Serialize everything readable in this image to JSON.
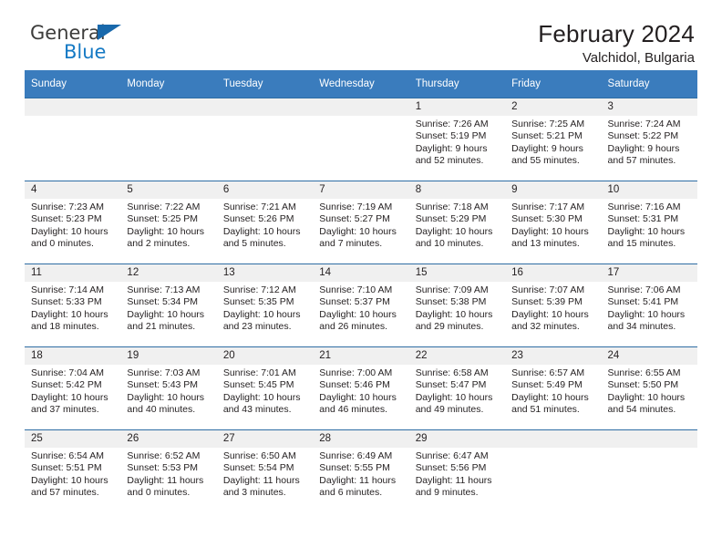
{
  "brand": {
    "name_top": "General",
    "name_bottom": "Blue",
    "triangle_color": "#1868ab",
    "blue_color": "#1479c4"
  },
  "header": {
    "title": "February 2024",
    "subtitle": "Valchidol, Bulgaria"
  },
  "theme": {
    "header_bg": "#3a7cbd",
    "row_rule": "#2e6da4",
    "daynum_band": "#f0f0f0"
  },
  "weekdays": [
    "Sunday",
    "Monday",
    "Tuesday",
    "Wednesday",
    "Thursday",
    "Friday",
    "Saturday"
  ],
  "weeks": [
    [
      {
        "day": "",
        "sunrise": "",
        "sunset": "",
        "daylight_1": "",
        "daylight_2": ""
      },
      {
        "day": "",
        "sunrise": "",
        "sunset": "",
        "daylight_1": "",
        "daylight_2": ""
      },
      {
        "day": "",
        "sunrise": "",
        "sunset": "",
        "daylight_1": "",
        "daylight_2": ""
      },
      {
        "day": "",
        "sunrise": "",
        "sunset": "",
        "daylight_1": "",
        "daylight_2": ""
      },
      {
        "day": "1",
        "sunrise": "Sunrise: 7:26 AM",
        "sunset": "Sunset: 5:19 PM",
        "daylight_1": "Daylight: 9 hours",
        "daylight_2": "and 52 minutes."
      },
      {
        "day": "2",
        "sunrise": "Sunrise: 7:25 AM",
        "sunset": "Sunset: 5:21 PM",
        "daylight_1": "Daylight: 9 hours",
        "daylight_2": "and 55 minutes."
      },
      {
        "day": "3",
        "sunrise": "Sunrise: 7:24 AM",
        "sunset": "Sunset: 5:22 PM",
        "daylight_1": "Daylight: 9 hours",
        "daylight_2": "and 57 minutes."
      }
    ],
    [
      {
        "day": "4",
        "sunrise": "Sunrise: 7:23 AM",
        "sunset": "Sunset: 5:23 PM",
        "daylight_1": "Daylight: 10 hours",
        "daylight_2": "and 0 minutes."
      },
      {
        "day": "5",
        "sunrise": "Sunrise: 7:22 AM",
        "sunset": "Sunset: 5:25 PM",
        "daylight_1": "Daylight: 10 hours",
        "daylight_2": "and 2 minutes."
      },
      {
        "day": "6",
        "sunrise": "Sunrise: 7:21 AM",
        "sunset": "Sunset: 5:26 PM",
        "daylight_1": "Daylight: 10 hours",
        "daylight_2": "and 5 minutes."
      },
      {
        "day": "7",
        "sunrise": "Sunrise: 7:19 AM",
        "sunset": "Sunset: 5:27 PM",
        "daylight_1": "Daylight: 10 hours",
        "daylight_2": "and 7 minutes."
      },
      {
        "day": "8",
        "sunrise": "Sunrise: 7:18 AM",
        "sunset": "Sunset: 5:29 PM",
        "daylight_1": "Daylight: 10 hours",
        "daylight_2": "and 10 minutes."
      },
      {
        "day": "9",
        "sunrise": "Sunrise: 7:17 AM",
        "sunset": "Sunset: 5:30 PM",
        "daylight_1": "Daylight: 10 hours",
        "daylight_2": "and 13 minutes."
      },
      {
        "day": "10",
        "sunrise": "Sunrise: 7:16 AM",
        "sunset": "Sunset: 5:31 PM",
        "daylight_1": "Daylight: 10 hours",
        "daylight_2": "and 15 minutes."
      }
    ],
    [
      {
        "day": "11",
        "sunrise": "Sunrise: 7:14 AM",
        "sunset": "Sunset: 5:33 PM",
        "daylight_1": "Daylight: 10 hours",
        "daylight_2": "and 18 minutes."
      },
      {
        "day": "12",
        "sunrise": "Sunrise: 7:13 AM",
        "sunset": "Sunset: 5:34 PM",
        "daylight_1": "Daylight: 10 hours",
        "daylight_2": "and 21 minutes."
      },
      {
        "day": "13",
        "sunrise": "Sunrise: 7:12 AM",
        "sunset": "Sunset: 5:35 PM",
        "daylight_1": "Daylight: 10 hours",
        "daylight_2": "and 23 minutes."
      },
      {
        "day": "14",
        "sunrise": "Sunrise: 7:10 AM",
        "sunset": "Sunset: 5:37 PM",
        "daylight_1": "Daylight: 10 hours",
        "daylight_2": "and 26 minutes."
      },
      {
        "day": "15",
        "sunrise": "Sunrise: 7:09 AM",
        "sunset": "Sunset: 5:38 PM",
        "daylight_1": "Daylight: 10 hours",
        "daylight_2": "and 29 minutes."
      },
      {
        "day": "16",
        "sunrise": "Sunrise: 7:07 AM",
        "sunset": "Sunset: 5:39 PM",
        "daylight_1": "Daylight: 10 hours",
        "daylight_2": "and 32 minutes."
      },
      {
        "day": "17",
        "sunrise": "Sunrise: 7:06 AM",
        "sunset": "Sunset: 5:41 PM",
        "daylight_1": "Daylight: 10 hours",
        "daylight_2": "and 34 minutes."
      }
    ],
    [
      {
        "day": "18",
        "sunrise": "Sunrise: 7:04 AM",
        "sunset": "Sunset: 5:42 PM",
        "daylight_1": "Daylight: 10 hours",
        "daylight_2": "and 37 minutes."
      },
      {
        "day": "19",
        "sunrise": "Sunrise: 7:03 AM",
        "sunset": "Sunset: 5:43 PM",
        "daylight_1": "Daylight: 10 hours",
        "daylight_2": "and 40 minutes."
      },
      {
        "day": "20",
        "sunrise": "Sunrise: 7:01 AM",
        "sunset": "Sunset: 5:45 PM",
        "daylight_1": "Daylight: 10 hours",
        "daylight_2": "and 43 minutes."
      },
      {
        "day": "21",
        "sunrise": "Sunrise: 7:00 AM",
        "sunset": "Sunset: 5:46 PM",
        "daylight_1": "Daylight: 10 hours",
        "daylight_2": "and 46 minutes."
      },
      {
        "day": "22",
        "sunrise": "Sunrise: 6:58 AM",
        "sunset": "Sunset: 5:47 PM",
        "daylight_1": "Daylight: 10 hours",
        "daylight_2": "and 49 minutes."
      },
      {
        "day": "23",
        "sunrise": "Sunrise: 6:57 AM",
        "sunset": "Sunset: 5:49 PM",
        "daylight_1": "Daylight: 10 hours",
        "daylight_2": "and 51 minutes."
      },
      {
        "day": "24",
        "sunrise": "Sunrise: 6:55 AM",
        "sunset": "Sunset: 5:50 PM",
        "daylight_1": "Daylight: 10 hours",
        "daylight_2": "and 54 minutes."
      }
    ],
    [
      {
        "day": "25",
        "sunrise": "Sunrise: 6:54 AM",
        "sunset": "Sunset: 5:51 PM",
        "daylight_1": "Daylight: 10 hours",
        "daylight_2": "and 57 minutes."
      },
      {
        "day": "26",
        "sunrise": "Sunrise: 6:52 AM",
        "sunset": "Sunset: 5:53 PM",
        "daylight_1": "Daylight: 11 hours",
        "daylight_2": "and 0 minutes."
      },
      {
        "day": "27",
        "sunrise": "Sunrise: 6:50 AM",
        "sunset": "Sunset: 5:54 PM",
        "daylight_1": "Daylight: 11 hours",
        "daylight_2": "and 3 minutes."
      },
      {
        "day": "28",
        "sunrise": "Sunrise: 6:49 AM",
        "sunset": "Sunset: 5:55 PM",
        "daylight_1": "Daylight: 11 hours",
        "daylight_2": "and 6 minutes."
      },
      {
        "day": "29",
        "sunrise": "Sunrise: 6:47 AM",
        "sunset": "Sunset: 5:56 PM",
        "daylight_1": "Daylight: 11 hours",
        "daylight_2": "and 9 minutes."
      },
      {
        "day": "",
        "sunrise": "",
        "sunset": "",
        "daylight_1": "",
        "daylight_2": ""
      },
      {
        "day": "",
        "sunrise": "",
        "sunset": "",
        "daylight_1": "",
        "daylight_2": ""
      }
    ]
  ]
}
